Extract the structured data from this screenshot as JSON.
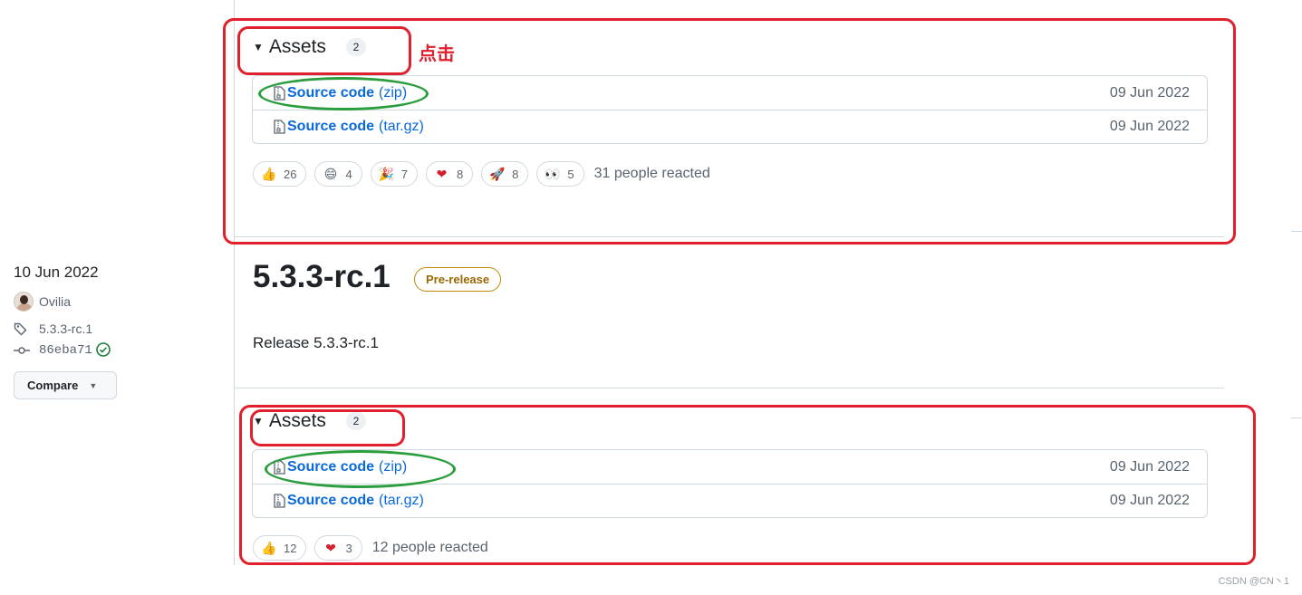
{
  "release_top": {
    "assets_title": "Assets",
    "assets_count": "2",
    "assets": [
      {
        "name": "Source code",
        "ext": "(zip)",
        "date": "09 Jun 2022"
      },
      {
        "name": "Source code",
        "ext": "(tar.gz)",
        "date": "09 Jun 2022"
      }
    ],
    "reactions": [
      {
        "icon": "thumbs-up-icon",
        "emoji": "👍",
        "count": "26"
      },
      {
        "icon": "laugh-icon",
        "emoji": "😄",
        "count": "4"
      },
      {
        "icon": "hooray-icon",
        "emoji": "🎉",
        "count": "7"
      },
      {
        "icon": "heart-icon",
        "emoji": "❤",
        "count": "8"
      },
      {
        "icon": "rocket-icon",
        "emoji": "🚀",
        "count": "8"
      },
      {
        "icon": "eyes-icon",
        "emoji": "👀",
        "count": "5"
      }
    ],
    "reacted_text": "31 people reacted"
  },
  "sidebar": {
    "date": "10 Jun 2022",
    "author": "Ovilia",
    "tag": "5.3.3-rc.1",
    "commit": "86eba71",
    "compare_label": "Compare"
  },
  "release": {
    "title": "5.3.3-rc.1",
    "badge": "Pre-release",
    "body": "Release 5.3.3-rc.1"
  },
  "release_bottom": {
    "assets_title": "Assets",
    "assets_count": "2",
    "assets": [
      {
        "name": "Source code",
        "ext": "(zip)",
        "date": "09 Jun 2022"
      },
      {
        "name": "Source code",
        "ext": "(tar.gz)",
        "date": "09 Jun 2022"
      }
    ],
    "reactions": [
      {
        "icon": "thumbs-up-icon",
        "emoji": "👍",
        "count": "12"
      },
      {
        "icon": "heart-icon",
        "emoji": "❤",
        "count": "3"
      }
    ],
    "reacted_text": "12 people reacted"
  },
  "annotation": {
    "click_label": "点击",
    "color_red": "#e0202c",
    "color_green": "#2a9d3c"
  },
  "watermark": "CSDN @CN丶1"
}
